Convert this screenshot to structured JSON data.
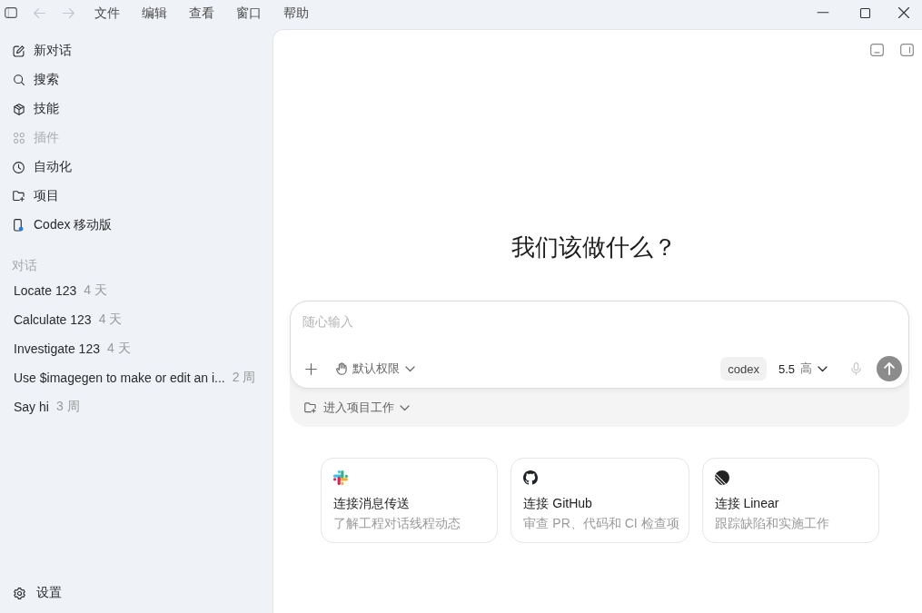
{
  "window": {
    "back": {
      "disabled": true
    },
    "forward": {
      "disabled": true
    },
    "menu": [
      "文件",
      "编辑",
      "查看",
      "窗口",
      "帮助"
    ]
  },
  "sidebar": {
    "items": [
      {
        "label": "新对话",
        "disabled": false,
        "notification": false
      },
      {
        "label": "搜索",
        "disabled": false,
        "notification": false
      },
      {
        "label": "技能",
        "disabled": false,
        "notification": false
      },
      {
        "label": "插件",
        "disabled": true,
        "notification": false
      },
      {
        "label": "自动化",
        "disabled": false,
        "notification": false
      },
      {
        "label": "项目",
        "disabled": false,
        "notification": false
      },
      {
        "label": "Codex 移动版",
        "disabled": false,
        "notification": true
      }
    ],
    "section_label": "对话",
    "conversations": [
      {
        "title": "Locate 123",
        "age": "4 天",
        "selected": false
      },
      {
        "title": "Calculate 123",
        "age": "4 天",
        "selected": false
      },
      {
        "title": "Investigate 123",
        "age": "4 天",
        "selected": false
      },
      {
        "title": "Use $imagegen to make or edit an i...",
        "age": "2 周",
        "selected": false
      },
      {
        "title": "Say hi",
        "age": "3 周",
        "selected": false
      }
    ],
    "settings": "设置"
  },
  "main": {
    "heading": "我们该做什么？",
    "composer": {
      "placeholder": "随心输入",
      "permission": "默认权限",
      "model": "codex",
      "version": "5.5",
      "effort": "高",
      "send": {
        "disabled": true
      },
      "project": "进入项目工作"
    },
    "cards": [
      {
        "title": "连接消息传送",
        "description": "了解工程对话线程动态"
      },
      {
        "title": "连接 GitHub",
        "description": "审查 PR、代码和 CI 检查项"
      },
      {
        "title": "连接 Linear",
        "description": "跟踪缺陷和实施工作"
      }
    ]
  }
}
